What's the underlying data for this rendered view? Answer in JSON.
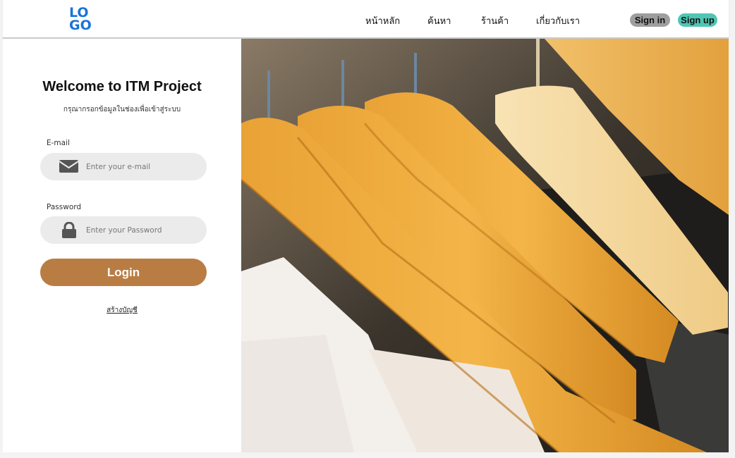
{
  "header": {
    "logo_line1": "LO",
    "logo_line2": "GO",
    "nav": [
      "หน้าหลัก",
      "ค้นหา",
      "ร้านค้า",
      "เกี่ยวกับเรา"
    ],
    "signin_label": "Sign in",
    "signup_label": "Sign up"
  },
  "login": {
    "title": "Welcome to ITM Project",
    "subtitle": "กรุณากรอกข้อมูลในช่องเพื่อเข้าสู่ระบบ",
    "email_label": "E-mail",
    "email_placeholder": "Enter your e-mail",
    "email_icon": "envelope-icon",
    "password_label": "Password",
    "password_placeholder": "Enter your Password",
    "password_icon": "lock-icon",
    "login_label": "Login",
    "create_account": "สร้างบัญชี"
  },
  "colors": {
    "brand_blue": "#1a73d9",
    "login_button": "#b97d44",
    "signin_bg": "#9e9e9e",
    "signup_bg": "#4fc6b4",
    "field_bg": "#ebebeb"
  }
}
